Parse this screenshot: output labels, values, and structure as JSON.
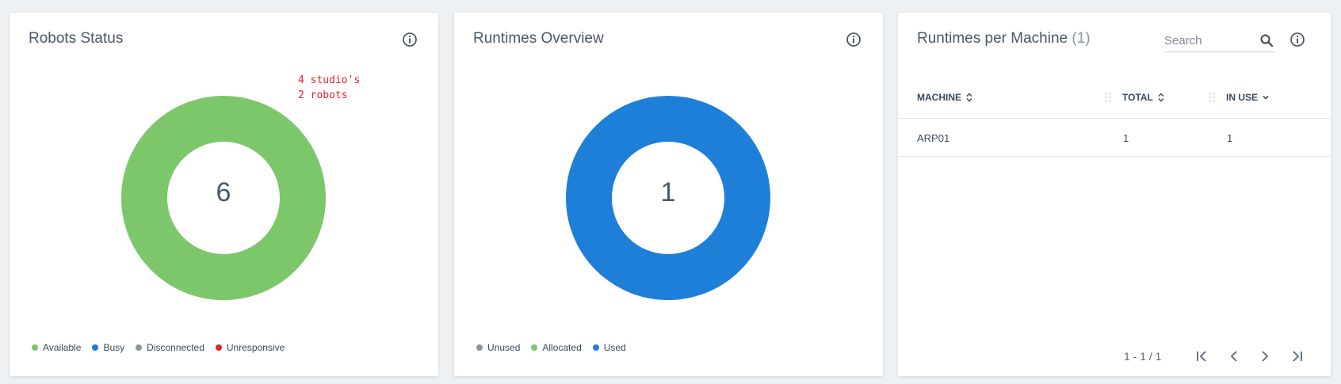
{
  "robots_status": {
    "title": "Robots Status",
    "center_value": "6",
    "annotation_line1": "4 studio's",
    "annotation_line2": "2 robots",
    "donut_color": "#7dc76b",
    "legend": [
      {
        "label": "Available",
        "color": "#7dc76b"
      },
      {
        "label": "Busy",
        "color": "#1e7fd8"
      },
      {
        "label": "Disconnected",
        "color": "#8f979e"
      },
      {
        "label": "Unresponsive",
        "color": "#d9262c"
      }
    ]
  },
  "runtimes_overview": {
    "title": "Runtimes Overview",
    "center_value": "1",
    "donut_color": "#1e7fd8",
    "legend": [
      {
        "label": "Unused",
        "color": "#8f979e"
      },
      {
        "label": "Allocated",
        "color": "#7dc76b"
      },
      {
        "label": "Used",
        "color": "#1e7fd8"
      }
    ]
  },
  "runtimes_per_machine": {
    "title": "Runtimes per Machine",
    "count": "(1)",
    "search_placeholder": "Search",
    "columns": [
      "MACHINE",
      "TOTAL",
      "IN USE"
    ],
    "rows": [
      {
        "machine": "ARP01",
        "total": "1",
        "in_use": "1"
      }
    ],
    "pager_text": "1 - 1 / 1"
  }
}
